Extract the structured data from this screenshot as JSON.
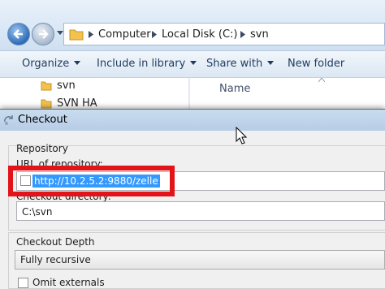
{
  "explorer": {
    "breadcrumbs": [
      "Computer",
      "Local Disk (C:)",
      "svn"
    ],
    "toolbar": {
      "organize": "Organize",
      "include": "Include in library",
      "share": "Share with",
      "newfolder": "New folder"
    },
    "nav_items": [
      "svn",
      "SVN HA"
    ],
    "column_header": "Name"
  },
  "dialog": {
    "title": "Checkout",
    "repository_group": "Repository",
    "url_label": "URL of repository:",
    "url_value": "http://10.2.5.2:9880/zelle",
    "dir_label": "Checkout directory:",
    "dir_value": "C:\\svn",
    "depth_group": "Checkout Depth",
    "depth_value": "Fully recursive",
    "omit_externals": "Omit externals"
  },
  "colors": {
    "highlight_box": "#e3131a",
    "selection": "#3399ff",
    "titlebar": "#c9dcf0"
  },
  "icons": [
    "back-arrow-icon",
    "forward-arrow-icon",
    "folder-icon",
    "svn-checkout-icon",
    "mouse-cursor-icon"
  ]
}
